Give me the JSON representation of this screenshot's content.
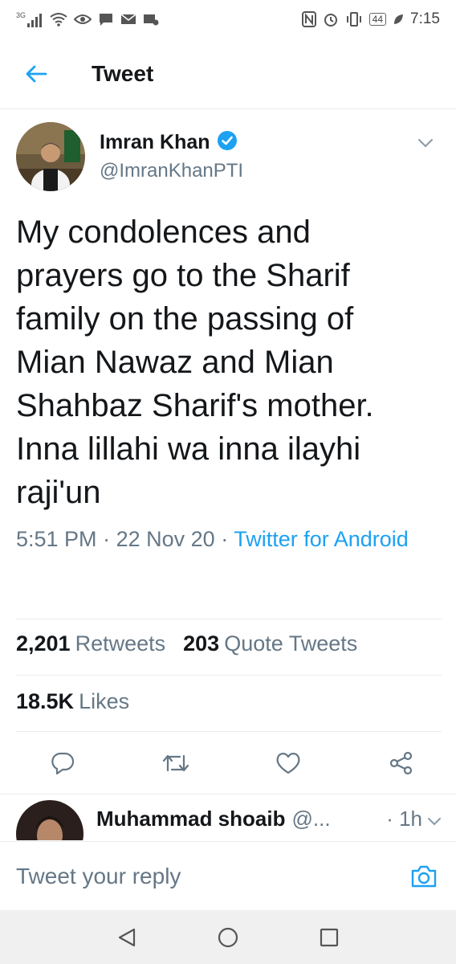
{
  "status_bar": {
    "network": "3G",
    "battery": "44",
    "time": "7:15"
  },
  "header": {
    "title": "Tweet"
  },
  "tweet": {
    "author_name": "Imran Khan",
    "author_handle": "@ImranKhanPTI",
    "verified": true,
    "text": "My condolences and\nprayers go to the Sharif\nfamily on the passing of\nMian Nawaz and Mian\nShahbaz Sharif's mother.\nInna lillahi wa inna ilayhi\nraji'un",
    "time": "5:51 PM",
    "date": "22 Nov 20",
    "source": "Twitter for Android"
  },
  "stats": {
    "retweets_count": "2,201",
    "retweets_label": "Retweets",
    "quotes_count": "203",
    "quotes_label": "Quote Tweets",
    "likes_count": "18.5K",
    "likes_label": "Likes"
  },
  "reply_preview": {
    "name": "Muhammad shoaib",
    "handle": "@...",
    "time": "· 1h"
  },
  "reply_bar": {
    "placeholder": "Tweet your reply"
  },
  "colors": {
    "accent": "#1da1f2",
    "secondary_text": "#657786",
    "primary_text": "#14171a"
  }
}
